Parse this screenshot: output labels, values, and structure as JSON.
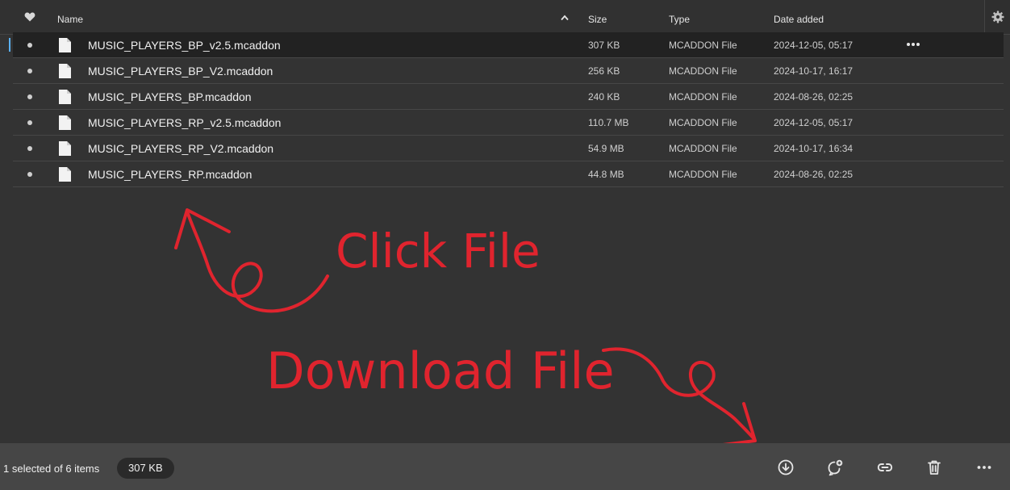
{
  "header": {
    "name_col": "Name",
    "size_col": "Size",
    "type_col": "Type",
    "date_col": "Date added"
  },
  "files": [
    {
      "name": "MUSIC_PLAYERS_BP_v2.5.mcaddon",
      "size": "307 KB",
      "type": "MCADDON File",
      "date": "2024-12-05, 05:17",
      "selected": true
    },
    {
      "name": "MUSIC_PLAYERS_BP_V2.mcaddon",
      "size": "256 KB",
      "type": "MCADDON File",
      "date": "2024-10-17, 16:17"
    },
    {
      "name": "MUSIC_PLAYERS_BP.mcaddon",
      "size": "240 KB",
      "type": "MCADDON File",
      "date": "2024-08-26, 02:25"
    },
    {
      "name": "MUSIC_PLAYERS_RP_v2.5.mcaddon",
      "size": "110.7 MB",
      "type": "MCADDON File",
      "date": "2024-12-05, 05:17"
    },
    {
      "name": "MUSIC_PLAYERS_RP_V2.mcaddon",
      "size": "54.9 MB",
      "type": "MCADDON File",
      "date": "2024-10-17, 16:34"
    },
    {
      "name": "MUSIC_PLAYERS_RP.mcaddon",
      "size": "44.8 MB",
      "type": "MCADDON File",
      "date": "2024-08-26, 02:25"
    }
  ],
  "annotations": {
    "click_text": "Click File",
    "download_text": "Download File",
    "color": "#e0242e"
  },
  "footer": {
    "status": "1 selected of 6 items",
    "selected_size": "307 KB",
    "actions": [
      "download-icon",
      "share-icon",
      "link-icon",
      "trash-icon",
      "more-icon"
    ]
  },
  "colors": {
    "background": "#333333",
    "selected_row": "#222222",
    "selection_accent": "#5ab0f0",
    "footer": "#464646"
  }
}
